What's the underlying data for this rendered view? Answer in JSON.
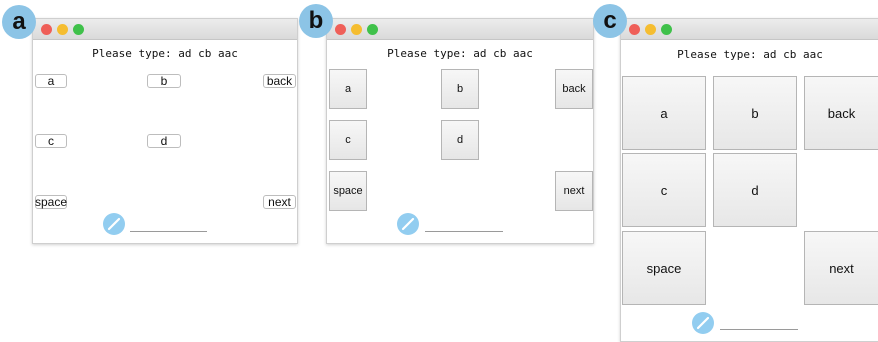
{
  "panels": {
    "a": {
      "badge": "a",
      "prompt": "Please type: ad cb aac",
      "keys": {
        "a": "a",
        "b": "b",
        "back": "back",
        "c": "c",
        "d": "d",
        "space": "space",
        "next": "next"
      }
    },
    "b": {
      "badge": "b",
      "prompt": "Please type: ad cb aac",
      "keys": {
        "a": "a",
        "b": "b",
        "back": "back",
        "c": "c",
        "d": "d",
        "space": "space",
        "next": "next"
      }
    },
    "c": {
      "badge": "c",
      "prompt": "Please type: ad cb aac",
      "keys": {
        "a": "a",
        "b": "b",
        "back": "back",
        "c": "c",
        "d": "d",
        "space": "space",
        "next": "next"
      }
    }
  },
  "colors": {
    "badge": "#8cc4e6",
    "pencil": "#92cdf0",
    "close": "#ef5f58",
    "minimize": "#f5bd30",
    "zoom": "#3fc14a"
  },
  "icons": {
    "status": "pencil-icon"
  }
}
